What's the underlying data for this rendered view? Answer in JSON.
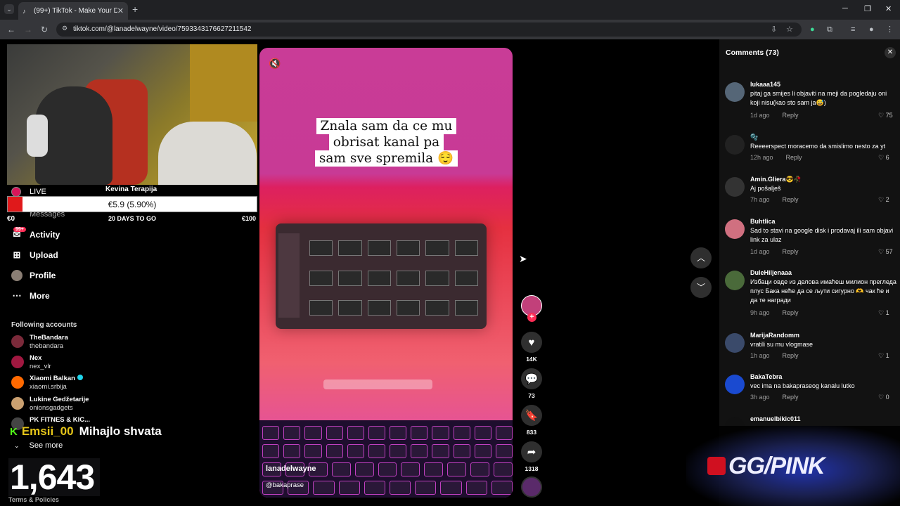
{
  "browser": {
    "tab_title": "(99+) TikTok - Make Your Day",
    "url": "tiktok.com/@lanadelwayne/video/7593343176627211542"
  },
  "stream_overlay": {
    "goal_title": "Kevina Terapija",
    "goal_text": "€5.9 (5.90%)",
    "goal_progress": 0.059,
    "goal_left": "€0",
    "goal_days": "20 DAYS TO GO",
    "goal_right": "€100",
    "chat_user": "Emsii_00",
    "chat_message": "Mihajlo shvata",
    "viewer_count": "1,643"
  },
  "sidebar": {
    "live_label": "LIVE",
    "messages_label": "Messages",
    "activity_badge": "99+",
    "nav": [
      {
        "label": "Activity",
        "icon": "activity-icon"
      },
      {
        "label": "Upload",
        "icon": "upload-icon"
      },
      {
        "label": "Profile",
        "icon": "profile-icon"
      },
      {
        "label": "More",
        "icon": "more-icon"
      }
    ],
    "following_title": "Following accounts",
    "accounts": [
      {
        "name": "TheBandara",
        "handle": "thebandara",
        "color": "#7b2a3a"
      },
      {
        "name": "Nex",
        "handle": "nex_vlr",
        "color": "#a01840"
      },
      {
        "name": "Xiaomi Balkan",
        "handle": "xiaomi.srbija",
        "color": "#ff6900"
      },
      {
        "name": "Lukine Gedžetarije",
        "handle": "onionsgadgets",
        "color": "#caa070"
      },
      {
        "name": "PK FITNES & KIC...",
        "handle": "",
        "color": "#444"
      }
    ],
    "see_more": "See more",
    "terms": "Terms & Policies"
  },
  "video": {
    "caption_lines": [
      "Znala sam da ce mu",
      "obrisat kanal pa",
      "sam sve spremila 😌"
    ],
    "username": "lanadelwayne",
    "mention": "@bakaprase"
  },
  "actions": {
    "likes": "14K",
    "comments": "73",
    "saves": "833",
    "shares": "1318"
  },
  "comments": {
    "title": "Comments (73)",
    "reply_label": "Reply",
    "items": [
      {
        "user": "lukaaa145",
        "text": "pitaj ga smijes li objaviti na meji da pogledaju oni koji nisu(kao sto sam ja😅)",
        "time": "1d ago",
        "likes": "75",
        "color": "#556677"
      },
      {
        "user": "🫧",
        "text": "Reeeerspect moracemo da smislimo nesto za yt",
        "time": "12h ago",
        "likes": "6",
        "color": "#222"
      },
      {
        "user": "Amin.Gliera😎🥀",
        "text": "Aj pošalješ",
        "time": "7h ago",
        "likes": "2",
        "color": "#333"
      },
      {
        "user": "Buhtlica",
        "text": "Sad to stavi na google disk i prodavaj ili sam objavi link za ulaz",
        "time": "1d ago",
        "likes": "57",
        "color": "#d07080"
      },
      {
        "user": "DuleHiljenaaa",
        "text": "Избаци овде из делова имаћеш милион прегледа плус Бака неће да се љути сигурно 🫶 чак ће и да те награди",
        "time": "9h ago",
        "likes": "1",
        "color": "#4a6a3a"
      },
      {
        "user": "MarijaRandomm",
        "text": "vratili su mu vlogmase",
        "time": "1h ago",
        "likes": "1",
        "color": "#3a4a6a"
      },
      {
        "user": "BakaTebra",
        "text": "vec ima na bakapraseog kanalu lutko",
        "time": "3h ago",
        "likes": "0",
        "color": "#1a4ad0"
      },
      {
        "user": "emanuelbikic011",
        "text": "",
        "time": "",
        "likes": "",
        "color": "#111"
      }
    ]
  },
  "logo": {
    "text": "GG/PINK"
  }
}
